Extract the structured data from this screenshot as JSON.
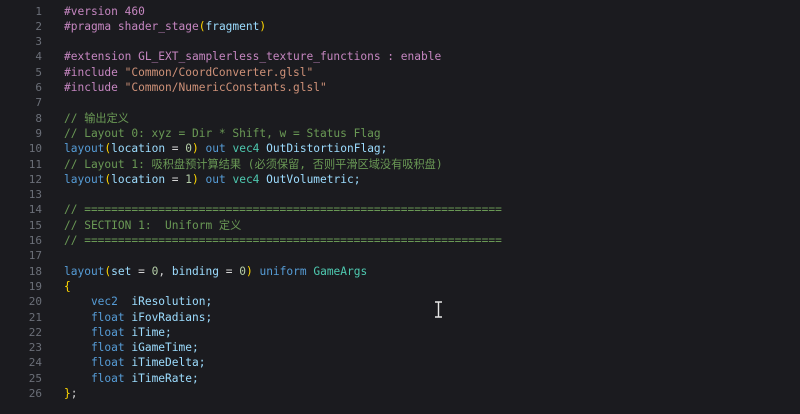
{
  "editor": {
    "line_numbers": [
      "1",
      "2",
      "3",
      "4",
      "5",
      "6",
      "7",
      "8",
      "9",
      "10",
      "11",
      "12",
      "13",
      "14",
      "15",
      "16",
      "17",
      "18",
      "19",
      "20",
      "21",
      "22",
      "23",
      "24",
      "25",
      "26"
    ],
    "lines": [
      {
        "segments": [
          {
            "t": "#version 460",
            "c": "dir"
          }
        ]
      },
      {
        "segments": [
          {
            "t": "#pragma shader_stage",
            "c": "dir"
          },
          {
            "t": "(",
            "c": "brc"
          },
          {
            "t": "fragment",
            "c": "var"
          },
          {
            "t": ")",
            "c": "brc"
          }
        ]
      },
      {
        "segments": []
      },
      {
        "segments": [
          {
            "t": "#extension GL_EXT_samplerless_texture_functions : enable",
            "c": "dir"
          }
        ]
      },
      {
        "segments": [
          {
            "t": "#include ",
            "c": "dir"
          },
          {
            "t": "\"Common/CoordConverter.glsl\"",
            "c": "str"
          }
        ]
      },
      {
        "segments": [
          {
            "t": "#include ",
            "c": "dir"
          },
          {
            "t": "\"Common/NumericConstants.glsl\"",
            "c": "str"
          }
        ]
      },
      {
        "segments": []
      },
      {
        "segments": [
          {
            "t": "// 输出定义",
            "c": "com"
          }
        ]
      },
      {
        "segments": [
          {
            "t": "// Layout 0: xyz = Dir * Shift, w = Status Flag",
            "c": "com"
          }
        ]
      },
      {
        "segments": [
          {
            "t": "layout",
            "c": "kb"
          },
          {
            "t": "(",
            "c": "brc"
          },
          {
            "t": "location",
            "c": "var"
          },
          {
            "t": " = ",
            "c": ""
          },
          {
            "t": "0",
            "c": "num"
          },
          {
            "t": ")",
            "c": "brc"
          },
          {
            "t": " out ",
            "c": "kb"
          },
          {
            "t": "vec4",
            "c": "typ"
          },
          {
            "t": " OutDistortionFlag;",
            "c": "var"
          }
        ]
      },
      {
        "segments": [
          {
            "t": "// Layout 1: 吸积盘预计算结果 (必须保留, 否则平滑区域没有吸积盘)",
            "c": "com"
          }
        ]
      },
      {
        "segments": [
          {
            "t": "layout",
            "c": "kb"
          },
          {
            "t": "(",
            "c": "brc"
          },
          {
            "t": "location",
            "c": "var"
          },
          {
            "t": " = ",
            "c": ""
          },
          {
            "t": "1",
            "c": "num"
          },
          {
            "t": ")",
            "c": "brc"
          },
          {
            "t": " out ",
            "c": "kb"
          },
          {
            "t": "vec4",
            "c": "typ"
          },
          {
            "t": " OutVolumetric;",
            "c": "var"
          }
        ]
      },
      {
        "segments": []
      },
      {
        "segments": [
          {
            "t": "// ==============================================================",
            "c": "com"
          }
        ]
      },
      {
        "segments": [
          {
            "t": "// SECTION 1:  Uniform 定义",
            "c": "com"
          }
        ]
      },
      {
        "segments": [
          {
            "t": "// ==============================================================",
            "c": "com"
          }
        ]
      },
      {
        "segments": []
      },
      {
        "segments": [
          {
            "t": "layout",
            "c": "kb"
          },
          {
            "t": "(",
            "c": "brc"
          },
          {
            "t": "set",
            "c": "var"
          },
          {
            "t": " = ",
            "c": ""
          },
          {
            "t": "0",
            "c": "num"
          },
          {
            "t": ", ",
            "c": ""
          },
          {
            "t": "binding",
            "c": "var"
          },
          {
            "t": " = ",
            "c": ""
          },
          {
            "t": "0",
            "c": "num"
          },
          {
            "t": ")",
            "c": "brc"
          },
          {
            "t": " uniform ",
            "c": "kb"
          },
          {
            "t": "GameArgs",
            "c": "typ"
          }
        ]
      },
      {
        "segments": [
          {
            "t": "{",
            "c": "brc"
          }
        ]
      },
      {
        "segments": [
          {
            "t": "    vec2",
            "c": "kb"
          },
          {
            "t": "  iResolution;",
            "c": "var"
          }
        ]
      },
      {
        "segments": [
          {
            "t": "    float",
            "c": "kb"
          },
          {
            "t": " iFovRadians;",
            "c": "var"
          }
        ]
      },
      {
        "segments": [
          {
            "t": "    float",
            "c": "kb"
          },
          {
            "t": " iTime;",
            "c": "var"
          }
        ]
      },
      {
        "segments": [
          {
            "t": "    float",
            "c": "kb"
          },
          {
            "t": " iGameTime;",
            "c": "var"
          }
        ]
      },
      {
        "segments": [
          {
            "t": "    float",
            "c": "kb"
          },
          {
            "t": " iTimeDelta;",
            "c": "var"
          }
        ]
      },
      {
        "segments": [
          {
            "t": "    float",
            "c": "kb"
          },
          {
            "t": " iTimeRate;",
            "c": "var"
          }
        ]
      },
      {
        "segments": [
          {
            "t": "}",
            "c": "brc"
          },
          {
            "t": ";",
            "c": ""
          }
        ]
      }
    ]
  },
  "cursor": {
    "icon": "text-cursor-icon"
  }
}
